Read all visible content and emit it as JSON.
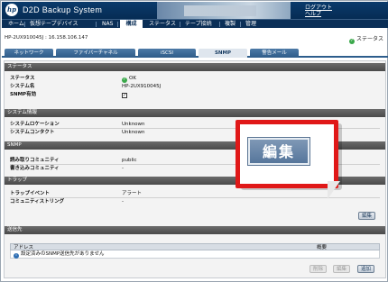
{
  "header": {
    "logo_text": "hp",
    "title": "D2D Backup System",
    "links": [
      "ログアウト",
      "ヘルプ"
    ]
  },
  "nav": {
    "items": [
      "ホーム",
      "仮想テープデバイス",
      "NAS",
      "構成",
      "ステータス",
      "テープ接続",
      "複製",
      "管理"
    ],
    "active": "構成"
  },
  "device": {
    "host_ip": "HP-2UX910045J : 16.158.106.147",
    "status_label": "ステータス"
  },
  "subtabs": {
    "items": [
      "ネットワーク",
      "ファイバーチャネル",
      "iSCSI",
      "SNMP",
      "警告メール"
    ],
    "active": "SNMP"
  },
  "sections": {
    "status": {
      "title": "ステータス",
      "status_key": "ステータス",
      "status_value": "OK",
      "system_name_key": "システム名",
      "system_name_value": "HP-2UX910045J",
      "snmp_enabled_key": "SNMP有効",
      "snmp_enabled_value": "✓"
    },
    "system_info": {
      "title": "システム情報",
      "location_key": "システムロケーション",
      "location_value": "Unknown",
      "contact_key": "システムコンタクト",
      "contact_value": "Unknown"
    },
    "snmp": {
      "title": "SNMP",
      "read_key": "読み取りコミュニティ",
      "read_value": "public",
      "write_key": "書き込みコミュニティ",
      "write_value": "-"
    },
    "trap": {
      "title": "トラップ",
      "event_key": "トラップイベント",
      "event_value": "アラート",
      "community_key": "コミュニティストリング",
      "community_value": "-",
      "edit_label": "編集"
    },
    "destinations": {
      "title": "送信先",
      "col_address": "アドレス",
      "col_summary": "概要",
      "empty_message": "設定済みのSNMP送信先がありません",
      "buttons": [
        "削除",
        "編集",
        "追加"
      ]
    }
  },
  "callout": {
    "label": "編集",
    "border_color": "#e01818"
  },
  "colors": {
    "header_bg": "#0a3a6b",
    "ok_green": "#3aa84a",
    "section_bar": "#5a5a5a"
  }
}
